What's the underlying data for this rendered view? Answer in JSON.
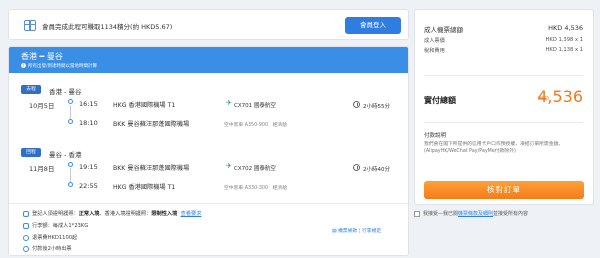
{
  "member_bar": {
    "text": "會員完成此程可賺取1134積分(約 HKD5.67)",
    "login_label": "會員登入"
  },
  "trip": {
    "title": "香港 ━ 曼谷",
    "note": "所有出發/到達時間以當地時間計算",
    "outbound": {
      "badge": "去程",
      "date": "10月5日",
      "route": "香港 - 曼谷",
      "dep_time": "16:15",
      "dep_airport": "HKG 香港國際機場 T1",
      "arr_time": "18:10",
      "arr_airport": "BKK 曼谷蘇汪那蓬國際機場",
      "flight": "CX701 國泰航空",
      "aircraft": "空中客車 A350-900",
      "cabin": "經濟艙",
      "duration": "2小時55分"
    },
    "inbound": {
      "badge": "回程",
      "date": "11月8日",
      "route": "曼谷 - 香港",
      "dep_time": "19:15",
      "dep_airport": "BKK 曼谷蘇汪那蓬國際機場",
      "arr_time": "22:55",
      "arr_airport": "HKG 香港國際機場 T1",
      "flight": "CX702 國泰航空",
      "aircraft": "空中客車 A330-300",
      "cabin": "經濟艙",
      "duration": "2小時40分"
    },
    "name_rule_prefix": "登記人須證明護照：",
    "name_rule_bold1": "正常入境",
    "name_rule_mid": "、香港入境證明護照：",
    "name_rule_bold2": "限制性入境",
    "name_rule_link": "查看要求",
    "baggage": "行李額：每成人1*23KG",
    "refund": "退票費HKD1100起",
    "payment": "付款後2小時出票",
    "fare_link1": "機票條款",
    "fare_link2": "行李規定"
  },
  "price": {
    "adult_total_label": "成人機票總額",
    "adult_total_value": "HKD 4,536",
    "fare_label": "成人票價",
    "fare_value": "HKD 1,398 x 1",
    "tax_label": "稅和費用",
    "tax_value": "HKD 1,138 x 1",
    "total_label": "實付總額",
    "total_currency": "HKD",
    "total_value": "4,536",
    "pay_title": "付款說明",
    "pay_text": "我們會在閣下所提供的信用卡戶口作預授權，凍結訂單所需金額。(AlipayHK/WeChat Pay/PayMe付款除外)",
    "checkout_label": "核對訂單"
  },
  "agree": {
    "prefix": "我接受—我已閱",
    "link": "機票條款及細則",
    "suffix": "並接受所有內容"
  }
}
